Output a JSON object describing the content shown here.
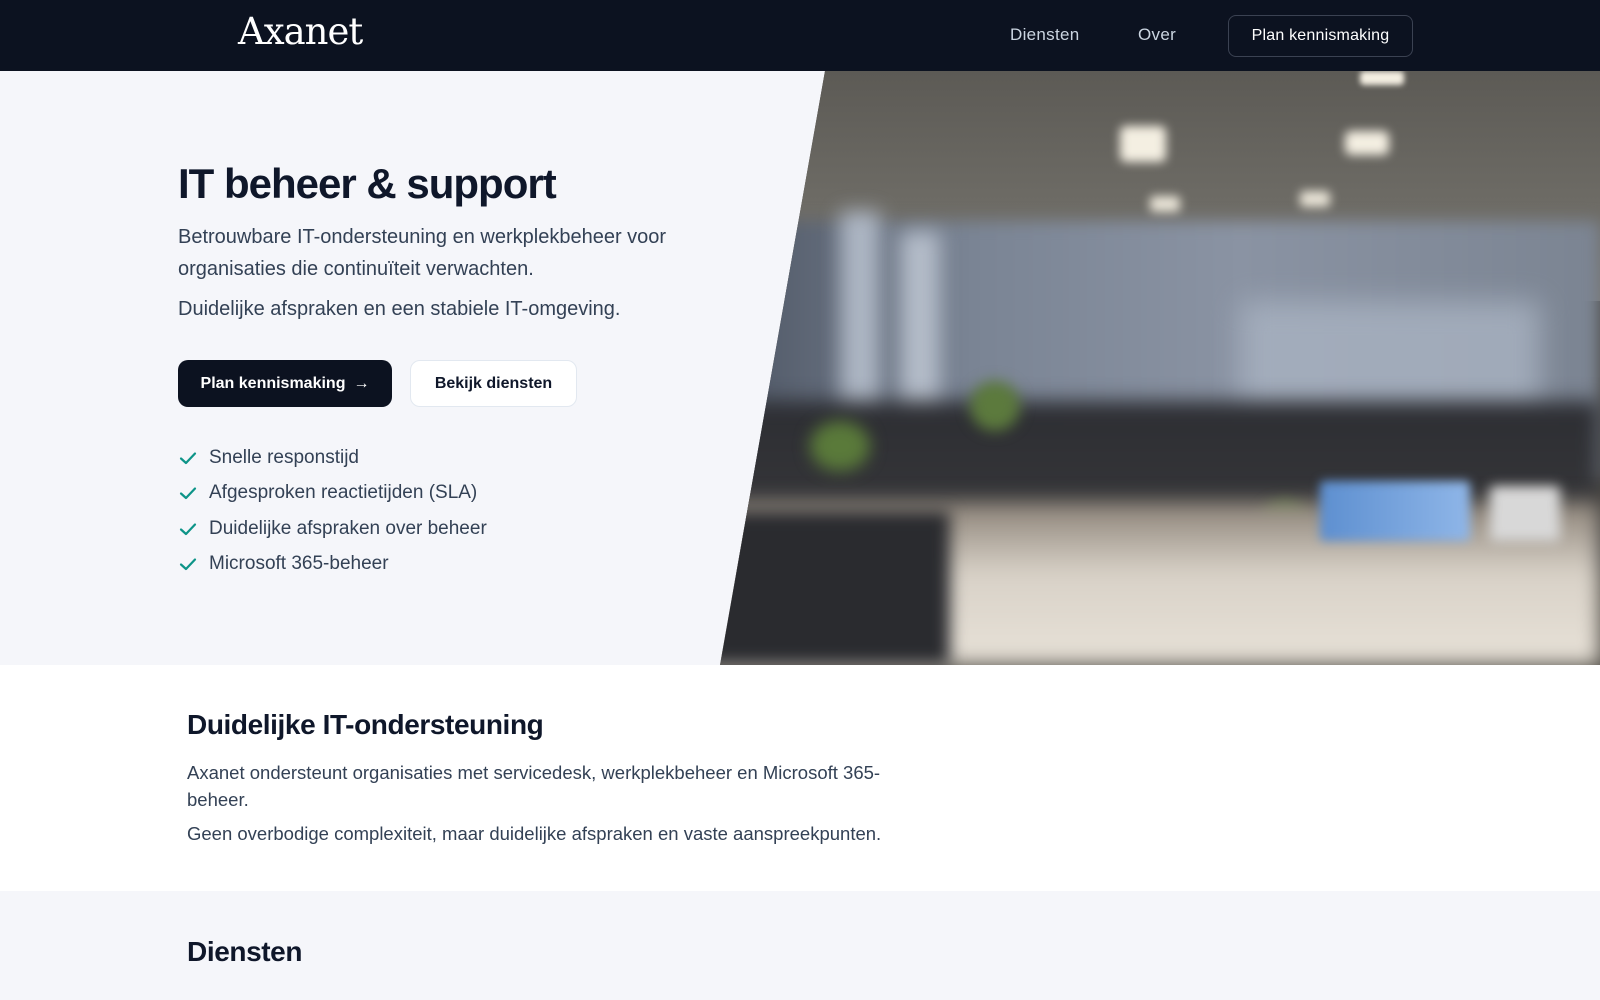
{
  "nav": {
    "logo": "Axanet",
    "links": [
      "Diensten",
      "Over"
    ],
    "cta": "Plan kennismaking"
  },
  "hero": {
    "title": "IT beheer & support",
    "subtitle": "Betrouwbare IT-ondersteuning en werkplekbeheer voor organisaties die continuïteit verwachten.",
    "subtitle2": "Duidelijke afspraken en een stabiele IT-omgeving.",
    "primary_button": "Plan kennismaking",
    "primary_arrow": "→",
    "secondary_button": "Bekijk diensten",
    "features": [
      "Snelle responstijd",
      "Afgesproken reactietijden (SLA)",
      "Duidelijke afspraken over beheer",
      "Microsoft 365-beheer"
    ],
    "image_icon": "office-photo"
  },
  "intro": {
    "title": "Duidelijke IT-ondersteuning",
    "p1": "Axanet ondersteunt organisaties met servicedesk, werkplekbeheer en Microsoft 365-beheer.",
    "p2": "Geen overbodige complexiteit, maar duidelijke afspraken en vaste aanspreekpunten."
  },
  "services": {
    "title": "Diensten"
  },
  "colors": {
    "nav_bg": "#0c1220",
    "hero_bg": "#f5f6fa",
    "accent_check": "#0d9488",
    "text_dark": "#0f172a",
    "text_body": "#334155"
  }
}
